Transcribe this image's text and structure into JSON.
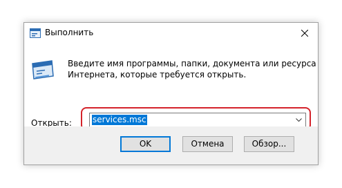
{
  "window": {
    "title": "Выполнить",
    "icon": "run-icon"
  },
  "description": {
    "line1": "Введите имя программы, папки, документа или ресурса",
    "line2": "Интернета, которые требуется открыть."
  },
  "open_field": {
    "label_underlined": "О",
    "label_rest": "ткрыть:",
    "value": "services.msc"
  },
  "buttons": {
    "ok": "OK",
    "cancel": "Отмена",
    "browse": "Обзор..."
  },
  "colors": {
    "highlight_frame": "#d4222a",
    "selection": "#0078d7",
    "footer_bg": "#f0f0f0"
  }
}
